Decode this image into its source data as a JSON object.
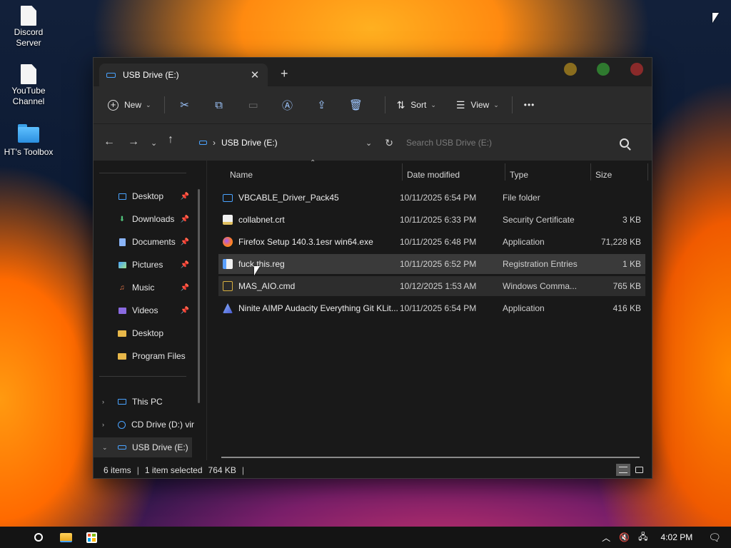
{
  "desktop": {
    "icons": [
      {
        "label_line1": "Discord",
        "label_line2": "Server",
        "icon": "document-icon"
      },
      {
        "label_line1": "YouTube",
        "label_line2": "Channel",
        "icon": "document-icon"
      },
      {
        "label_line1": "HT's Toolbox",
        "label_line2": "",
        "icon": "folder-icon"
      }
    ]
  },
  "window": {
    "tab_title": "USB Drive (E:)",
    "tab_close": "✕",
    "new_tab": "+",
    "traffic_colors": [
      "#8a6d1e",
      "#2f7a2f",
      "#8a2a2a"
    ],
    "toolbar": {
      "new_label": "New",
      "sort_label": "Sort",
      "view_label": "View",
      "more_label": "•••",
      "icons": [
        "cut-icon",
        "copy-icon",
        "paste-icon",
        "rename-icon",
        "share-icon",
        "delete-icon"
      ]
    },
    "address": {
      "path": "USB Drive (E:)",
      "search_placeholder": "Search USB Drive (E:)"
    },
    "sidebar": {
      "items": [
        {
          "label": "Desktop",
          "icon": "desktop-icon",
          "pinned": true
        },
        {
          "label": "Downloads",
          "icon": "download-icon",
          "pinned": true
        },
        {
          "label": "Documents",
          "icon": "documents-icon",
          "pinned": true
        },
        {
          "label": "Pictures",
          "icon": "pictures-icon",
          "pinned": true
        },
        {
          "label": "Music",
          "icon": "music-icon",
          "pinned": true
        },
        {
          "label": "Videos",
          "icon": "videos-icon",
          "pinned": true
        },
        {
          "label": "Desktop",
          "icon": "folder-icon",
          "pinned": false
        },
        {
          "label": "Program Files",
          "icon": "folder-icon",
          "pinned": false
        }
      ],
      "drives": [
        {
          "label": "This PC",
          "icon": "pc-icon",
          "expand": "›"
        },
        {
          "label": "CD Drive (D:) vir",
          "icon": "cd-drive-icon",
          "expand": "›"
        },
        {
          "label": "USB Drive (E:)",
          "icon": "usb-drive-icon",
          "expand": "⌄"
        }
      ]
    },
    "columns": {
      "name": "Name",
      "date_modified": "Date modified",
      "type": "Type",
      "size": "Size"
    },
    "files": [
      {
        "name": "VBCABLE_Driver_Pack45",
        "date": "10/11/2025 6:54 PM",
        "type": "File folder",
        "size": "",
        "icon": "folder-icon",
        "icon_color": "#4aa3ff",
        "state": "normal"
      },
      {
        "name": "collabnet.crt",
        "date": "10/11/2025 6:33 PM",
        "type": "Security Certificate",
        "size": "3 KB",
        "icon": "certificate-icon",
        "icon_color": "#e0c060",
        "state": "normal"
      },
      {
        "name": "Firefox Setup 140.3.1esr win64.exe",
        "date": "10/11/2025 6:48 PM",
        "type": "Application",
        "size": "71,228 KB",
        "icon": "firefox-icon",
        "icon_color": "#ff7a2a",
        "state": "normal"
      },
      {
        "name": "fuck this.reg",
        "date": "10/11/2025 6:52 PM",
        "type": "Registration Entries",
        "size": "1 KB",
        "icon": "registry-icon",
        "icon_color": "#5aa0ff",
        "state": "selected"
      },
      {
        "name": "MAS_AIO.cmd",
        "date": "10/12/2025 1:53 AM",
        "type": "Windows Comma...",
        "size": "765 KB",
        "icon": "cmd-icon",
        "icon_color": "#d8b040",
        "state": "hover"
      },
      {
        "name": "Ninite AIMP Audacity Everything Git KLit...",
        "date": "10/11/2025 6:54 PM",
        "type": "Application",
        "size": "416 KB",
        "icon": "ninite-icon",
        "icon_color": "#5a7ae0",
        "state": "normal"
      }
    ],
    "status": {
      "items_count": "6 items",
      "selection": "1 item selected",
      "selection_size": "764 KB"
    }
  },
  "taskbar": {
    "icons": [
      "apple-icon",
      "search-icon",
      "file-explorer-icon",
      "store-icon"
    ],
    "time": "4:02 PM"
  }
}
